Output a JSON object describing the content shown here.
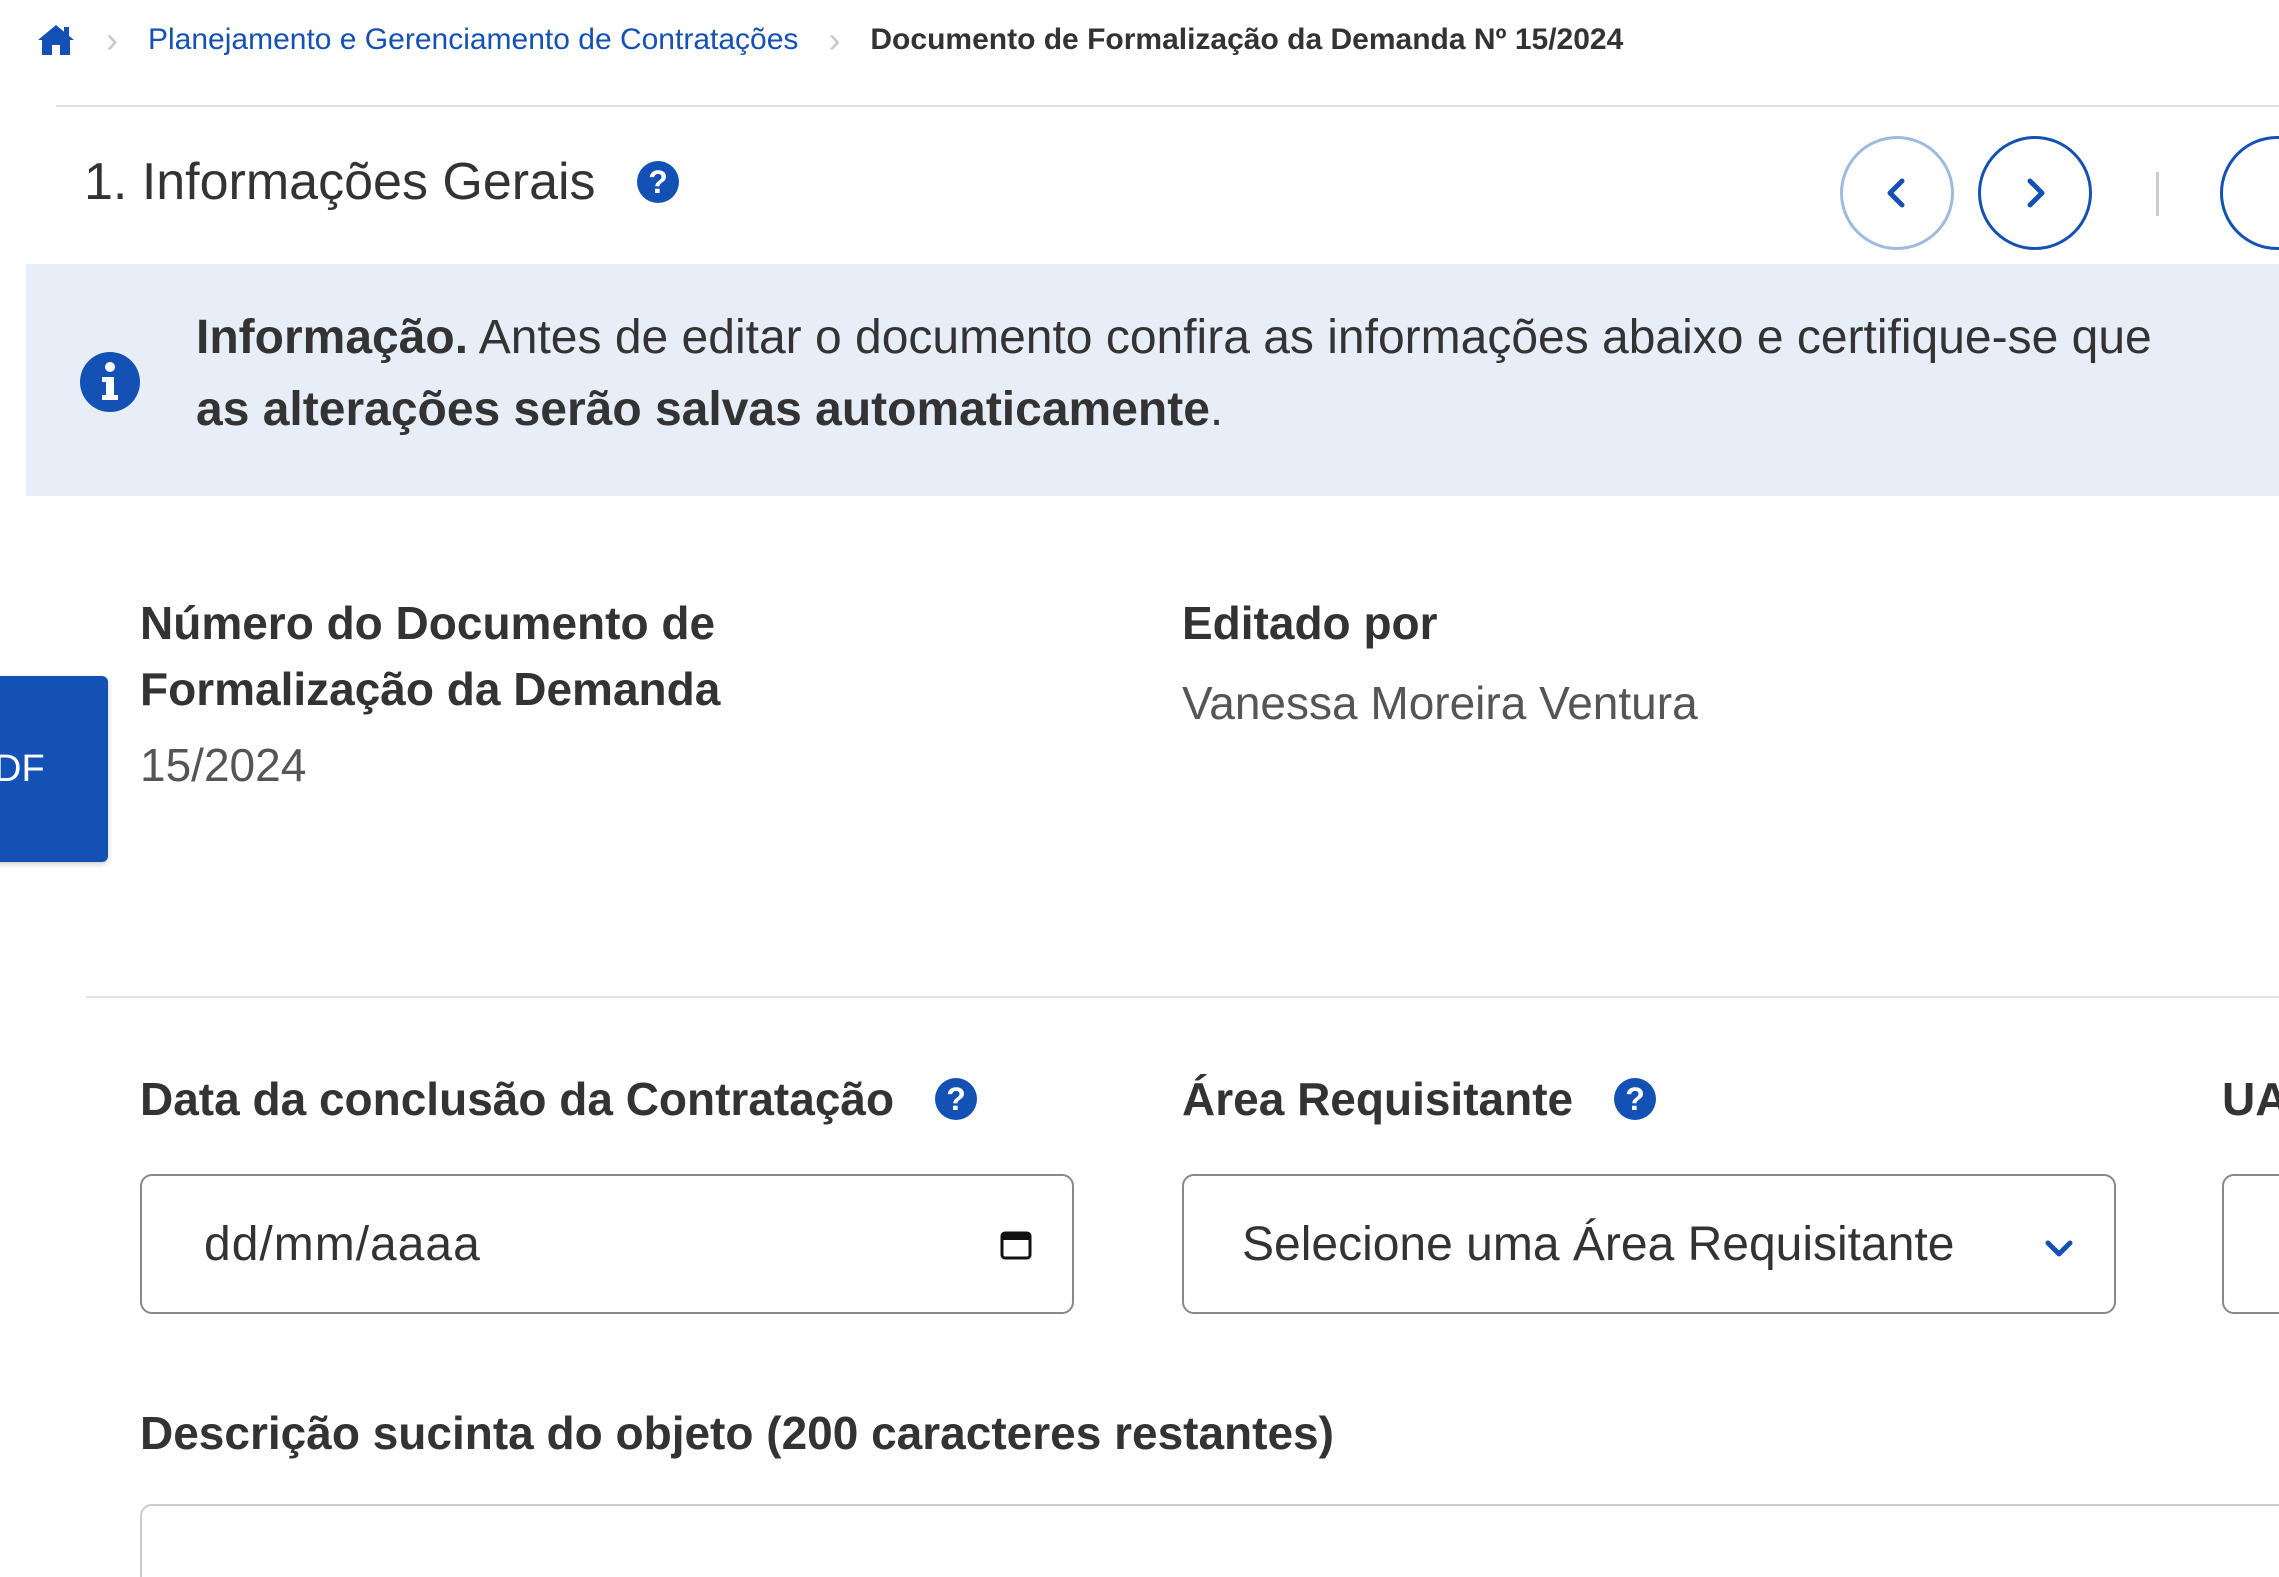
{
  "breadcrumb": {
    "home_icon": "home-icon",
    "items": [
      "Planejamento e Gerenciamento de Contratações",
      "Documento de Formalização da Demanda Nº 15/2024"
    ]
  },
  "section": {
    "title": "1. Informações Gerais"
  },
  "alert": {
    "strong": "Informação.",
    "text": " Antes de editar o documento confira as informações abaixo e certifique-se que",
    "strong2": "as alterações serão salvas automaticamente",
    "end": "."
  },
  "side_tab": {
    "label": "DF"
  },
  "document_number": {
    "label_line1": "Número do Documento de",
    "label_line2": "Formalização da Demanda",
    "value": "15/2024"
  },
  "edited_by": {
    "label": "Editado por",
    "value": "Vanessa Moreira Ventura"
  },
  "date_field": {
    "label": "Data da conclusão da Contratação",
    "placeholder": "dd/mm/aaaa"
  },
  "area_field": {
    "label": "Área Requisitante",
    "selected": "Selecione uma Área Requisitante"
  },
  "ua_field": {
    "label": "UA"
  },
  "description_field": {
    "label": "Descrição sucinta do objeto (200 caracteres restantes)"
  },
  "colors": {
    "primary": "#1351b4",
    "alert_bg": "#e8eef7",
    "text": "#333333"
  }
}
